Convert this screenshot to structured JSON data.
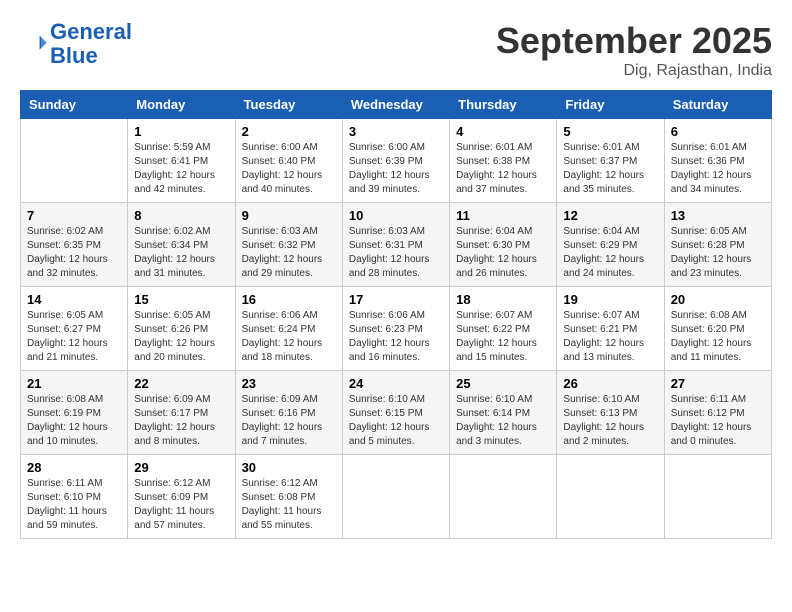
{
  "logo": {
    "line1": "General",
    "line2": "Blue"
  },
  "title": "September 2025",
  "location": "Dig, Rajasthan, India",
  "weekdays": [
    "Sunday",
    "Monday",
    "Tuesday",
    "Wednesday",
    "Thursday",
    "Friday",
    "Saturday"
  ],
  "weeks": [
    [
      {
        "day": "",
        "info": ""
      },
      {
        "day": "1",
        "info": "Sunrise: 5:59 AM\nSunset: 6:41 PM\nDaylight: 12 hours\nand 42 minutes."
      },
      {
        "day": "2",
        "info": "Sunrise: 6:00 AM\nSunset: 6:40 PM\nDaylight: 12 hours\nand 40 minutes."
      },
      {
        "day": "3",
        "info": "Sunrise: 6:00 AM\nSunset: 6:39 PM\nDaylight: 12 hours\nand 39 minutes."
      },
      {
        "day": "4",
        "info": "Sunrise: 6:01 AM\nSunset: 6:38 PM\nDaylight: 12 hours\nand 37 minutes."
      },
      {
        "day": "5",
        "info": "Sunrise: 6:01 AM\nSunset: 6:37 PM\nDaylight: 12 hours\nand 35 minutes."
      },
      {
        "day": "6",
        "info": "Sunrise: 6:01 AM\nSunset: 6:36 PM\nDaylight: 12 hours\nand 34 minutes."
      }
    ],
    [
      {
        "day": "7",
        "info": "Sunrise: 6:02 AM\nSunset: 6:35 PM\nDaylight: 12 hours\nand 32 minutes."
      },
      {
        "day": "8",
        "info": "Sunrise: 6:02 AM\nSunset: 6:34 PM\nDaylight: 12 hours\nand 31 minutes."
      },
      {
        "day": "9",
        "info": "Sunrise: 6:03 AM\nSunset: 6:32 PM\nDaylight: 12 hours\nand 29 minutes."
      },
      {
        "day": "10",
        "info": "Sunrise: 6:03 AM\nSunset: 6:31 PM\nDaylight: 12 hours\nand 28 minutes."
      },
      {
        "day": "11",
        "info": "Sunrise: 6:04 AM\nSunset: 6:30 PM\nDaylight: 12 hours\nand 26 minutes."
      },
      {
        "day": "12",
        "info": "Sunrise: 6:04 AM\nSunset: 6:29 PM\nDaylight: 12 hours\nand 24 minutes."
      },
      {
        "day": "13",
        "info": "Sunrise: 6:05 AM\nSunset: 6:28 PM\nDaylight: 12 hours\nand 23 minutes."
      }
    ],
    [
      {
        "day": "14",
        "info": "Sunrise: 6:05 AM\nSunset: 6:27 PM\nDaylight: 12 hours\nand 21 minutes."
      },
      {
        "day": "15",
        "info": "Sunrise: 6:05 AM\nSunset: 6:26 PM\nDaylight: 12 hours\nand 20 minutes."
      },
      {
        "day": "16",
        "info": "Sunrise: 6:06 AM\nSunset: 6:24 PM\nDaylight: 12 hours\nand 18 minutes."
      },
      {
        "day": "17",
        "info": "Sunrise: 6:06 AM\nSunset: 6:23 PM\nDaylight: 12 hours\nand 16 minutes."
      },
      {
        "day": "18",
        "info": "Sunrise: 6:07 AM\nSunset: 6:22 PM\nDaylight: 12 hours\nand 15 minutes."
      },
      {
        "day": "19",
        "info": "Sunrise: 6:07 AM\nSunset: 6:21 PM\nDaylight: 12 hours\nand 13 minutes."
      },
      {
        "day": "20",
        "info": "Sunrise: 6:08 AM\nSunset: 6:20 PM\nDaylight: 12 hours\nand 11 minutes."
      }
    ],
    [
      {
        "day": "21",
        "info": "Sunrise: 6:08 AM\nSunset: 6:19 PM\nDaylight: 12 hours\nand 10 minutes."
      },
      {
        "day": "22",
        "info": "Sunrise: 6:09 AM\nSunset: 6:17 PM\nDaylight: 12 hours\nand 8 minutes."
      },
      {
        "day": "23",
        "info": "Sunrise: 6:09 AM\nSunset: 6:16 PM\nDaylight: 12 hours\nand 7 minutes."
      },
      {
        "day": "24",
        "info": "Sunrise: 6:10 AM\nSunset: 6:15 PM\nDaylight: 12 hours\nand 5 minutes."
      },
      {
        "day": "25",
        "info": "Sunrise: 6:10 AM\nSunset: 6:14 PM\nDaylight: 12 hours\nand 3 minutes."
      },
      {
        "day": "26",
        "info": "Sunrise: 6:10 AM\nSunset: 6:13 PM\nDaylight: 12 hours\nand 2 minutes."
      },
      {
        "day": "27",
        "info": "Sunrise: 6:11 AM\nSunset: 6:12 PM\nDaylight: 12 hours\nand 0 minutes."
      }
    ],
    [
      {
        "day": "28",
        "info": "Sunrise: 6:11 AM\nSunset: 6:10 PM\nDaylight: 11 hours\nand 59 minutes."
      },
      {
        "day": "29",
        "info": "Sunrise: 6:12 AM\nSunset: 6:09 PM\nDaylight: 11 hours\nand 57 minutes."
      },
      {
        "day": "30",
        "info": "Sunrise: 6:12 AM\nSunset: 6:08 PM\nDaylight: 11 hours\nand 55 minutes."
      },
      {
        "day": "",
        "info": ""
      },
      {
        "day": "",
        "info": ""
      },
      {
        "day": "",
        "info": ""
      },
      {
        "day": "",
        "info": ""
      }
    ]
  ]
}
